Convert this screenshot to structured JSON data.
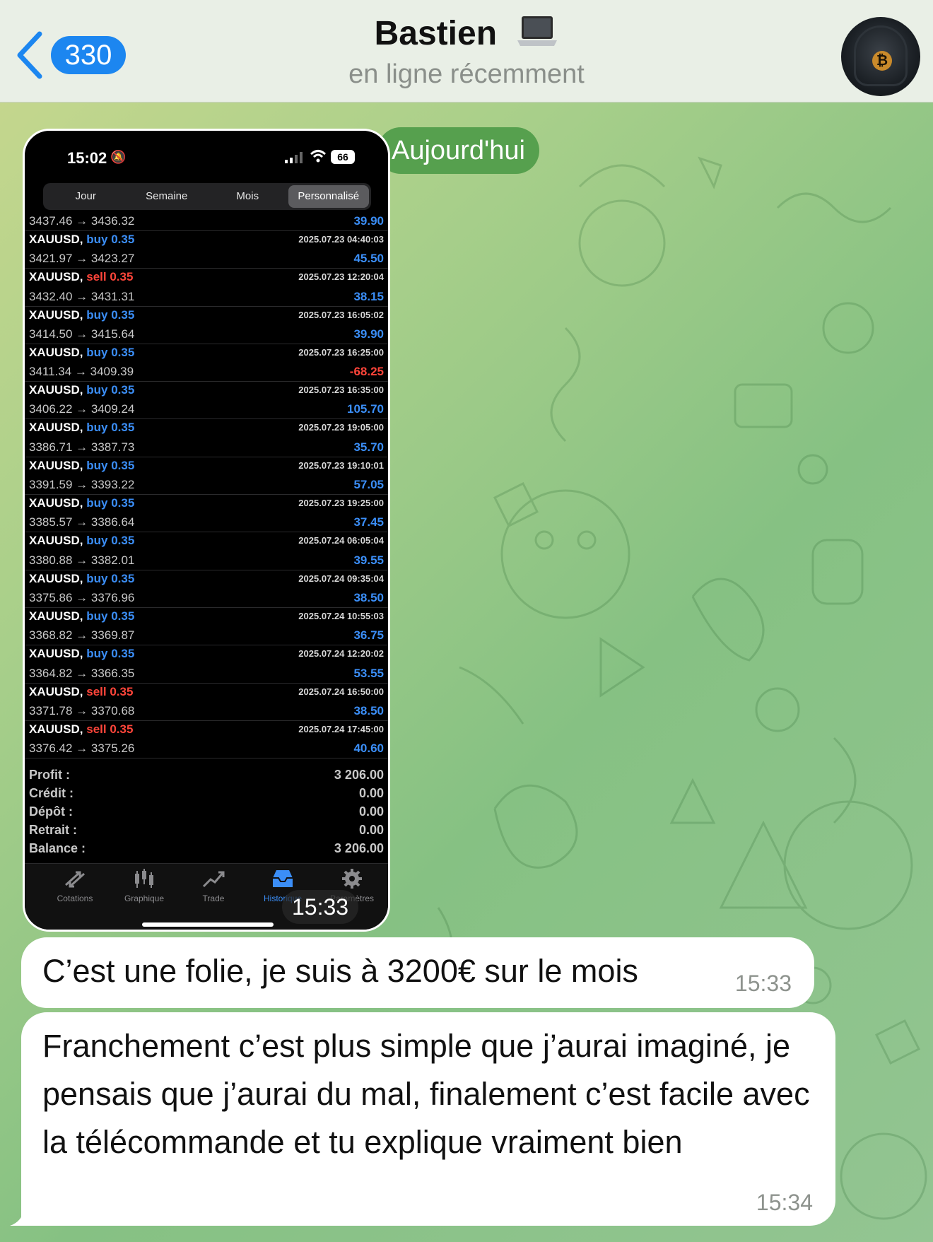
{
  "header": {
    "back_count": "330",
    "title": "Bastien",
    "title_emoji": "laptop-icon",
    "subtitle": "en ligne récemment"
  },
  "date_pill": "Aujourd'hui",
  "screenshot": {
    "status": {
      "time": "15:02",
      "battery": "66"
    },
    "segments": [
      "Jour",
      "Semaine",
      "Mois",
      "Personnalisé"
    ],
    "active_segment": "Personnalisé",
    "first_row": {
      "prices": "3437.46 → 3436.32",
      "profit": "39.90"
    },
    "trades": [
      {
        "symbol": "XAUUSD,",
        "side": "buy",
        "volume": "buy 0.35",
        "date": "2025.07.23 04:40:03",
        "prices": "3421.97 → 3423.27",
        "profit": "45.50"
      },
      {
        "symbol": "XAUUSD,",
        "side": "sell",
        "volume": "sell 0.35",
        "date": "2025.07.23 12:20:04",
        "prices": "3432.40 → 3431.31",
        "profit": "38.15"
      },
      {
        "symbol": "XAUUSD,",
        "side": "buy",
        "volume": "buy 0.35",
        "date": "2025.07.23 16:05:02",
        "prices": "3414.50 → 3415.64",
        "profit": "39.90"
      },
      {
        "symbol": "XAUUSD,",
        "side": "buy",
        "volume": "buy 0.35",
        "date": "2025.07.23 16:25:00",
        "prices": "3411.34 → 3409.39",
        "profit": "-68.25"
      },
      {
        "symbol": "XAUUSD,",
        "side": "buy",
        "volume": "buy 0.35",
        "date": "2025.07.23 16:35:00",
        "prices": "3406.22 → 3409.24",
        "profit": "105.70"
      },
      {
        "symbol": "XAUUSD,",
        "side": "buy",
        "volume": "buy 0.35",
        "date": "2025.07.23 19:05:00",
        "prices": "3386.71 → 3387.73",
        "profit": "35.70"
      },
      {
        "symbol": "XAUUSD,",
        "side": "buy",
        "volume": "buy 0.35",
        "date": "2025.07.23 19:10:01",
        "prices": "3391.59 → 3393.22",
        "profit": "57.05"
      },
      {
        "symbol": "XAUUSD,",
        "side": "buy",
        "volume": "buy 0.35",
        "date": "2025.07.23 19:25:00",
        "prices": "3385.57 → 3386.64",
        "profit": "37.45"
      },
      {
        "symbol": "XAUUSD,",
        "side": "buy",
        "volume": "buy 0.35",
        "date": "2025.07.24 06:05:04",
        "prices": "3380.88 → 3382.01",
        "profit": "39.55"
      },
      {
        "symbol": "XAUUSD,",
        "side": "buy",
        "volume": "buy 0.35",
        "date": "2025.07.24 09:35:04",
        "prices": "3375.86 → 3376.96",
        "profit": "38.50"
      },
      {
        "symbol": "XAUUSD,",
        "side": "buy",
        "volume": "buy 0.35",
        "date": "2025.07.24 10:55:03",
        "prices": "3368.82 → 3369.87",
        "profit": "36.75"
      },
      {
        "symbol": "XAUUSD,",
        "side": "buy",
        "volume": "buy 0.35",
        "date": "2025.07.24 12:20:02",
        "prices": "3364.82 → 3366.35",
        "profit": "53.55"
      },
      {
        "symbol": "XAUUSD,",
        "side": "sell",
        "volume": "sell 0.35",
        "date": "2025.07.24 16:50:00",
        "prices": "3371.78 → 3370.68",
        "profit": "38.50"
      },
      {
        "symbol": "XAUUSD,",
        "side": "sell",
        "volume": "sell 0.35",
        "date": "2025.07.24 17:45:00",
        "prices": "3376.42 → 3375.26",
        "profit": "40.60"
      }
    ],
    "summary": [
      {
        "label": "Profit :",
        "value": "3 206.00"
      },
      {
        "label": "Crédit :",
        "value": "0.00"
      },
      {
        "label": "Dépôt :",
        "value": "0.00"
      },
      {
        "label": "Retrait :",
        "value": "0.00"
      },
      {
        "label": "Balance :",
        "value": "3 206.00"
      }
    ],
    "tabs": [
      "Cotations",
      "Graphique",
      "Trade",
      "Historique",
      "Paramètres"
    ],
    "active_tab": "Historique",
    "sent_time": "15:33"
  },
  "messages": [
    {
      "text": "C’est une folie, je suis à 3200€ sur le mois",
      "time": "15:33"
    },
    {
      "text": "Franchement c’est plus simple que j’aurai imaginé, je pensais que j’aurai du mal, finalement c’est facile avec la télécommande et tu explique vraiment bien",
      "time": "15:34"
    }
  ],
  "colors": {
    "accent": "#1c86f0",
    "buy": "#3b8ef7",
    "sell": "#ff453a",
    "date_pill": "#56a04e"
  }
}
